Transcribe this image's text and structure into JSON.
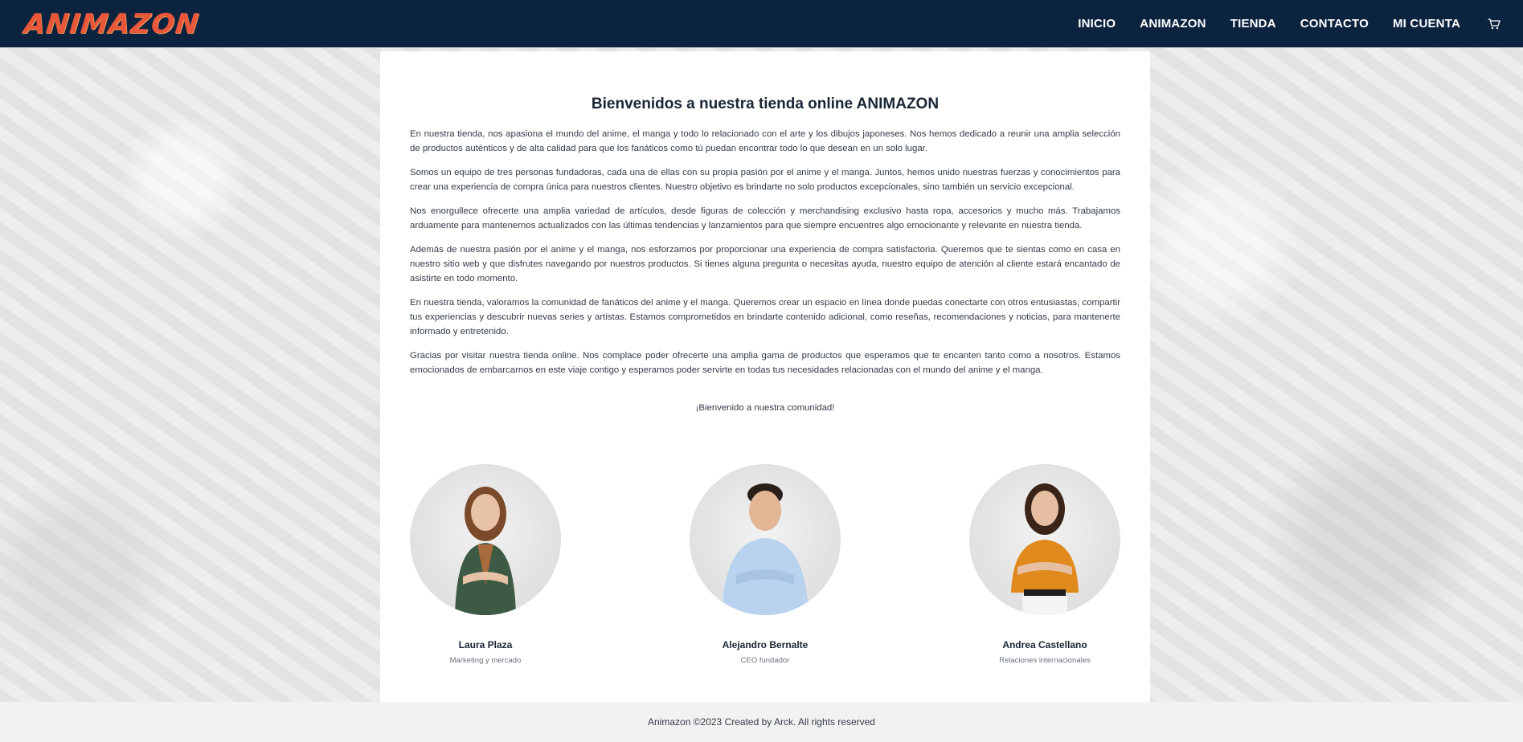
{
  "brand": {
    "logo_text": "ANIMAZON",
    "logo_color": "#e8573a"
  },
  "nav": {
    "links": [
      "INICIO",
      "ANIMAZON",
      "TIENDA",
      "CONTACTO",
      "MI CUENTA"
    ],
    "cart_icon": "shopping-cart-icon"
  },
  "colors": {
    "navbar": "#0c2340",
    "text": "#1a2535",
    "card": "#ffffff"
  },
  "main": {
    "title": "Bienvenidos a nuestra tienda online ANIMAZON",
    "paragraphs": [
      "En nuestra tienda, nos apasiona el mundo del anime, el manga y todo lo relacionado con el arte y los dibujos japoneses. Nos hemos dedicado a reunir una amplia selección de productos auténticos y de alta calidad para que los fanáticos como tú puedan encontrar todo lo que desean en un solo lugar.",
      "Somos un equipo de tres personas fundadoras, cada una de ellas con su propia pasión por el anime y el manga. Juntos, hemos unido nuestras fuerzas y conocimientos para crear una experiencia de compra única para nuestros clientes. Nuestro objetivo es brindarte no solo productos excepcionales, sino también un servicio excepcional.",
      "Nos enorgullece ofrecerte una amplia variedad de artículos, desde figuras de colección y merchandising exclusivo hasta ropa, accesorios y mucho más. Trabajamos arduamente para mantenernos actualizados con las últimas tendencias y lanzamientos para que siempre encuentres algo emocionante y relevante en nuestra tienda.",
      "Además de nuestra pasión por el anime y el manga, nos esforzamos por proporcionar una experiencia de compra satisfactoria. Queremos que te sientas como en casa en nuestro sitio web y que disfrutes navegando por nuestros productos. Si tienes alguna pregunta o necesitas ayuda, nuestro equipo de atención al cliente estará encantado de asistirte en todo momento.",
      "En nuestra tienda, valoramos la comunidad de fanáticos del anime y el manga. Queremos crear un espacio en línea donde puedas conectarte con otros entusiastas, compartir tus experiencias y descubrir nuevas series y artistas. Estamos comprometidos en brindarte contenido adicional, como reseñas, recomendaciones y noticias, para mantenerte informado y entretenido.",
      "Gracias por visitar nuestra tienda online. Nos complace poder ofrecerte una amplia gama de productos que esperamos que te encanten tanto como a nosotros. Estamos emocionados de embarcarnos en este viaje contigo y esperamos poder servirte en todas tus necesidades relacionadas con el mundo del anime y el manga."
    ],
    "welcome": "¡Bienvenido a nuestra comunidad!"
  },
  "team": [
    {
      "name": "Laura Plaza",
      "role": "Marketing y mercado",
      "shirt": "#3d5a45",
      "hair": "#7a4a2a"
    },
    {
      "name": "Alejandro Bernalte",
      "role": "CEO fundador",
      "shirt": "#b9d3ee",
      "hair": "#2a1f18"
    },
    {
      "name": "Andrea Castellano",
      "role": "Relaciones internacionales",
      "shirt": "#e08a1e",
      "hair": "#3a2418"
    }
  ],
  "footer": {
    "text": "Animazon ©2023 Created by Arck. All rights reserved"
  }
}
